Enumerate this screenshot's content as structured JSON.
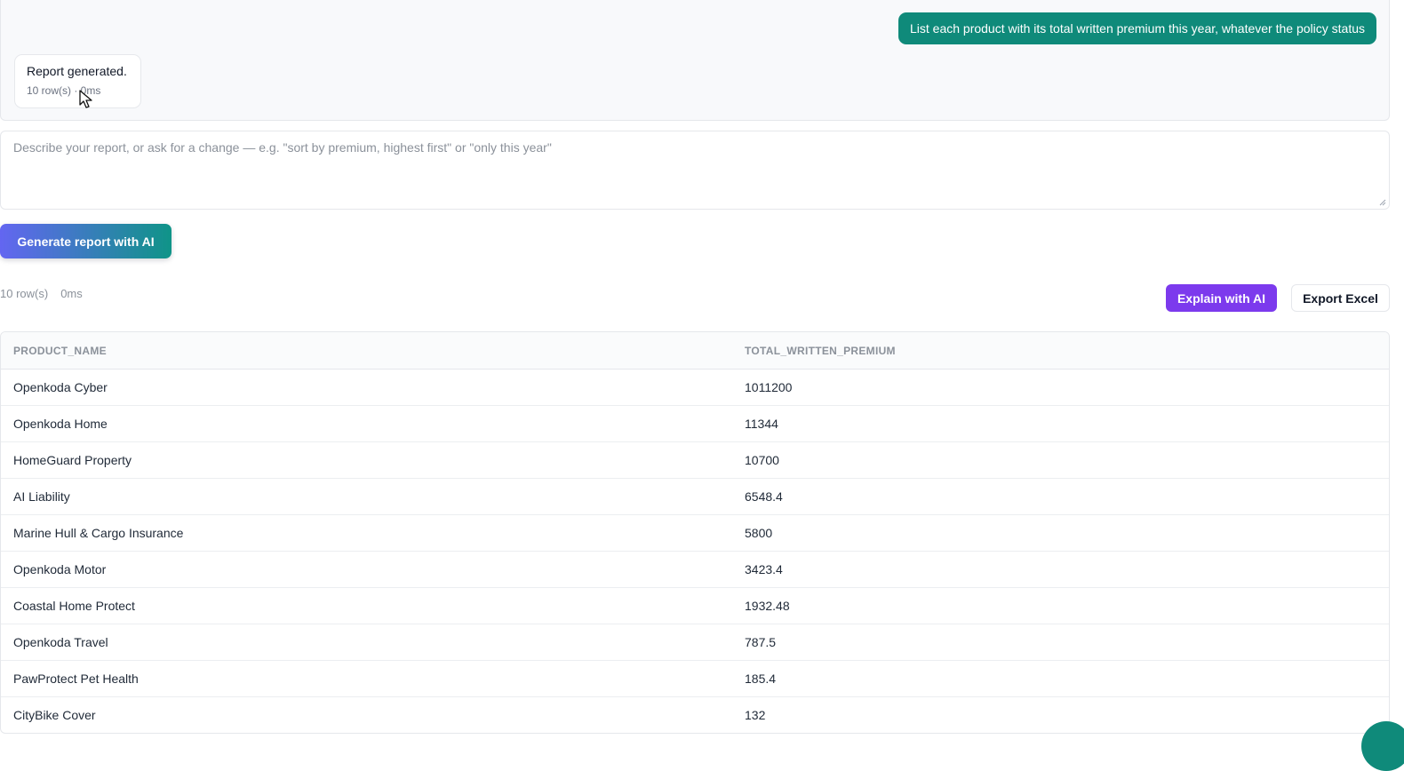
{
  "chat": {
    "user_message": "List each product with its total written premium this year, whatever the policy status",
    "ai_message": "Report generated.",
    "ai_meta": "10 row(s) · 0ms"
  },
  "prompt": {
    "placeholder": "Describe your report, or ask for a change — e.g. \"sort by premium, highest first\" or \"only this year\"",
    "value": ""
  },
  "actions": {
    "generate_label": "Generate report with AI",
    "explain_label": "Explain with AI",
    "export_label": "Export Excel"
  },
  "result": {
    "row_count": "10 row(s)",
    "duration": "0ms"
  },
  "table": {
    "columns": [
      "PRODUCT_NAME",
      "TOTAL_WRITTEN_PREMIUM"
    ],
    "rows": [
      [
        "Openkoda Cyber",
        "1011200"
      ],
      [
        "Openkoda Home",
        "11344"
      ],
      [
        "HomeGuard Property",
        "10700"
      ],
      [
        "AI Liability",
        "6548.4"
      ],
      [
        "Marine Hull & Cargo Insurance",
        "5800"
      ],
      [
        "Openkoda Motor",
        "3423.4"
      ],
      [
        "Coastal Home Protect",
        "1932.48"
      ],
      [
        "Openkoda Travel",
        "787.5"
      ],
      [
        "PawProtect Pet Health",
        "185.4"
      ],
      [
        "CityBike Cover",
        "132"
      ]
    ]
  },
  "colors": {
    "accent_teal": "#0f8a7a",
    "accent_purple": "#7c3aed",
    "gradient_start": "#6366f1",
    "gradient_end": "#0f9488"
  }
}
